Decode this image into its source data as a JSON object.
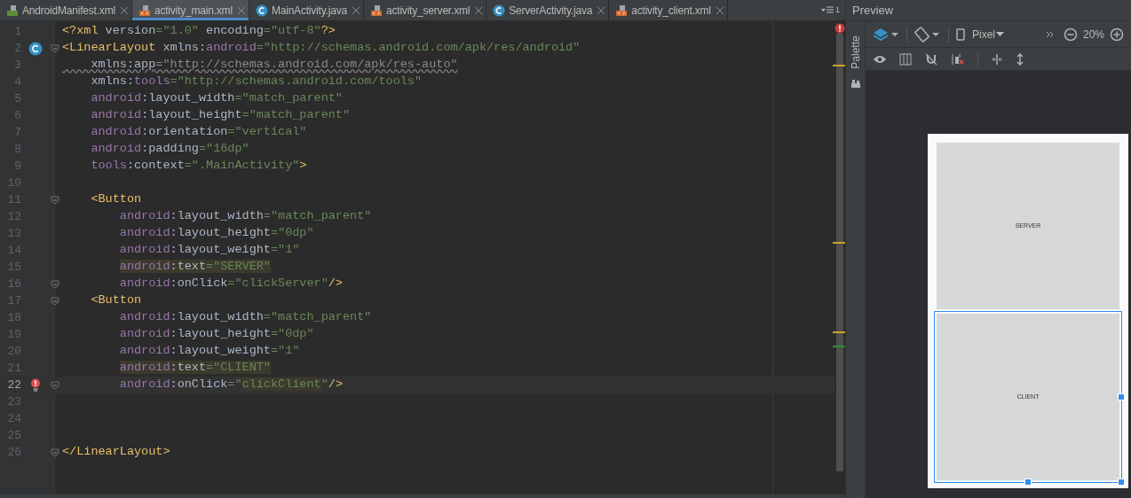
{
  "tabs": [
    {
      "label": "AndroidManifest.xml",
      "kind": "manifest",
      "selected": false
    },
    {
      "label": "activity_main.xml",
      "kind": "layout",
      "selected": true
    },
    {
      "label": "MainActivity.java",
      "kind": "class",
      "selected": false
    },
    {
      "label": "activity_server.xml",
      "kind": "layout",
      "selected": false
    },
    {
      "label": "ServerActivity.java",
      "kind": "class",
      "selected": false
    },
    {
      "label": "activity_client.xml",
      "kind": "layout",
      "selected": false
    }
  ],
  "tab_overflow_count": "1",
  "editor": {
    "lines": [
      {
        "number": "1",
        "tokens": [
          {
            "kind": "tag",
            "text": "<?xml "
          },
          {
            "kind": "name",
            "text": "version"
          },
          {
            "kind": "value",
            "text": "=\"1.0\" "
          },
          {
            "kind": "name",
            "text": "encoding"
          },
          {
            "kind": "value",
            "text": "=\"utf-8\""
          },
          {
            "kind": "tag",
            "text": "?>"
          }
        ]
      },
      {
        "number": "2",
        "kind": "class",
        "fold": true,
        "tokens": [
          {
            "kind": "tag",
            "text": "<LinearLayout "
          },
          {
            "kind": "name",
            "text": "xmlns:"
          },
          {
            "kind": "ns",
            "text": "android"
          },
          {
            "kind": "value",
            "text": "=\"http://schemas.android.com/apk/res/android\""
          }
        ]
      },
      {
        "number": "3",
        "warning": true,
        "tokens": [
          {
            "kind": "name",
            "text": "    xmlns:app"
          },
          {
            "kind": "value",
            "text": "=\"http://schemas.android.com/apk/res-auto\""
          }
        ]
      },
      {
        "number": "4",
        "tokens": [
          {
            "kind": "name",
            "text": "    xmlns:"
          },
          {
            "kind": "ns",
            "text": "tools"
          },
          {
            "kind": "value",
            "text": "=\"http://schemas.android.com/tools\""
          }
        ]
      },
      {
        "number": "5",
        "tokens": [
          {
            "kind": "ns",
            "text": "    android"
          },
          {
            "kind": "name",
            "text": ":layout_width"
          },
          {
            "kind": "value",
            "text": "=\"match_parent\""
          }
        ]
      },
      {
        "number": "6",
        "tokens": [
          {
            "kind": "ns",
            "text": "    android"
          },
          {
            "kind": "name",
            "text": ":layout_height"
          },
          {
            "kind": "value",
            "text": "=\"match_parent\""
          }
        ]
      },
      {
        "number": "7",
        "tokens": [
          {
            "kind": "ns",
            "text": "    android"
          },
          {
            "kind": "name",
            "text": ":orientation"
          },
          {
            "kind": "value",
            "text": "=\"vertical\""
          }
        ]
      },
      {
        "number": "8",
        "tokens": [
          {
            "kind": "ns",
            "text": "    android"
          },
          {
            "kind": "name",
            "text": ":padding"
          },
          {
            "kind": "value",
            "text": "=\"16dp\""
          }
        ]
      },
      {
        "number": "9",
        "tokens": [
          {
            "kind": "ns",
            "text": "    tools"
          },
          {
            "kind": "name",
            "text": ":context"
          },
          {
            "kind": "value",
            "text": "=\".MainActivity\""
          },
          {
            "kind": "tag",
            "text": ">"
          }
        ]
      },
      {
        "number": "10"
      },
      {
        "number": "11",
        "fold": true,
        "tokens": [
          {
            "kind": "tag",
            "text": "    <Button"
          }
        ]
      },
      {
        "number": "12",
        "tokens": [
          {
            "kind": "ns",
            "text": "        android"
          },
          {
            "kind": "name",
            "text": ":layout_width"
          },
          {
            "kind": "value",
            "text": "=\"match_parent\""
          }
        ]
      },
      {
        "number": "13",
        "tokens": [
          {
            "kind": "ns",
            "text": "        android"
          },
          {
            "kind": "name",
            "text": ":layout_height"
          },
          {
            "kind": "value",
            "text": "=\"0dp\""
          }
        ]
      },
      {
        "number": "14",
        "tokens": [
          {
            "kind": "ns",
            "text": "        android"
          },
          {
            "kind": "name",
            "text": ":layout_weight"
          },
          {
            "kind": "value",
            "text": "=\"1\""
          }
        ]
      },
      {
        "number": "15",
        "tokens": [
          {
            "kind": "ns",
            "text": "        android",
            "highlighted": true
          },
          {
            "kind": "name",
            "text": ":text",
            "highlighted": true
          },
          {
            "kind": "value",
            "text": "=\"SERVER\"",
            "highlighted": true
          }
        ]
      },
      {
        "number": "16",
        "fold": true,
        "tokens": [
          {
            "kind": "ns",
            "text": "        android"
          },
          {
            "kind": "name",
            "text": ":onClick"
          },
          {
            "kind": "value",
            "text": "=\"clickServer\""
          },
          {
            "kind": "tag",
            "text": "/>"
          }
        ]
      },
      {
        "number": "17",
        "fold": true,
        "tokens": [
          {
            "kind": "tag",
            "text": "    <Button"
          }
        ]
      },
      {
        "number": "18",
        "tokens": [
          {
            "kind": "ns",
            "text": "        android"
          },
          {
            "kind": "name",
            "text": ":layout_width"
          },
          {
            "kind": "value",
            "text": "=\"match_parent\""
          }
        ]
      },
      {
        "number": "19",
        "tokens": [
          {
            "kind": "ns",
            "text": "        android"
          },
          {
            "kind": "name",
            "text": ":layout_height"
          },
          {
            "kind": "value",
            "text": "=\"0dp\""
          }
        ]
      },
      {
        "number": "20",
        "tokens": [
          {
            "kind": "ns",
            "text": "        android"
          },
          {
            "kind": "name",
            "text": ":layout_weight"
          },
          {
            "kind": "value",
            "text": "=\"1\""
          }
        ]
      },
      {
        "number": "21",
        "tokens": [
          {
            "kind": "ns",
            "text": "        android",
            "highlighted": true
          },
          {
            "kind": "name",
            "text": ":text",
            "highlighted": true
          },
          {
            "kind": "value",
            "text": "=\"CLIENT\"",
            "highlighted": true
          }
        ]
      },
      {
        "number": "22",
        "current": true,
        "kind": "error",
        "fold": true,
        "tokens": [
          {
            "kind": "ns",
            "text": "        android"
          },
          {
            "kind": "name",
            "text": ":onClick"
          },
          {
            "kind": "value",
            "text": "=\""
          },
          {
            "kind": "value",
            "text": "clickClient",
            "highlighted": true
          },
          {
            "kind": "value",
            "text": "\""
          },
          {
            "kind": "tag",
            "text": "/>"
          }
        ]
      },
      {
        "number": "23"
      },
      {
        "number": "24"
      },
      {
        "number": "25"
      },
      {
        "number": "26",
        "fold": true,
        "tokens": [
          {
            "kind": "tag",
            "text": "</LinearLayout>"
          }
        ]
      }
    ]
  },
  "preview": {
    "title": "Preview",
    "palette": "Palette",
    "device": "Pixel",
    "zoom": "20%",
    "buttons": [
      {
        "label": "SERVER",
        "selected": false
      },
      {
        "label": "CLIENT",
        "selected": true
      }
    ]
  }
}
